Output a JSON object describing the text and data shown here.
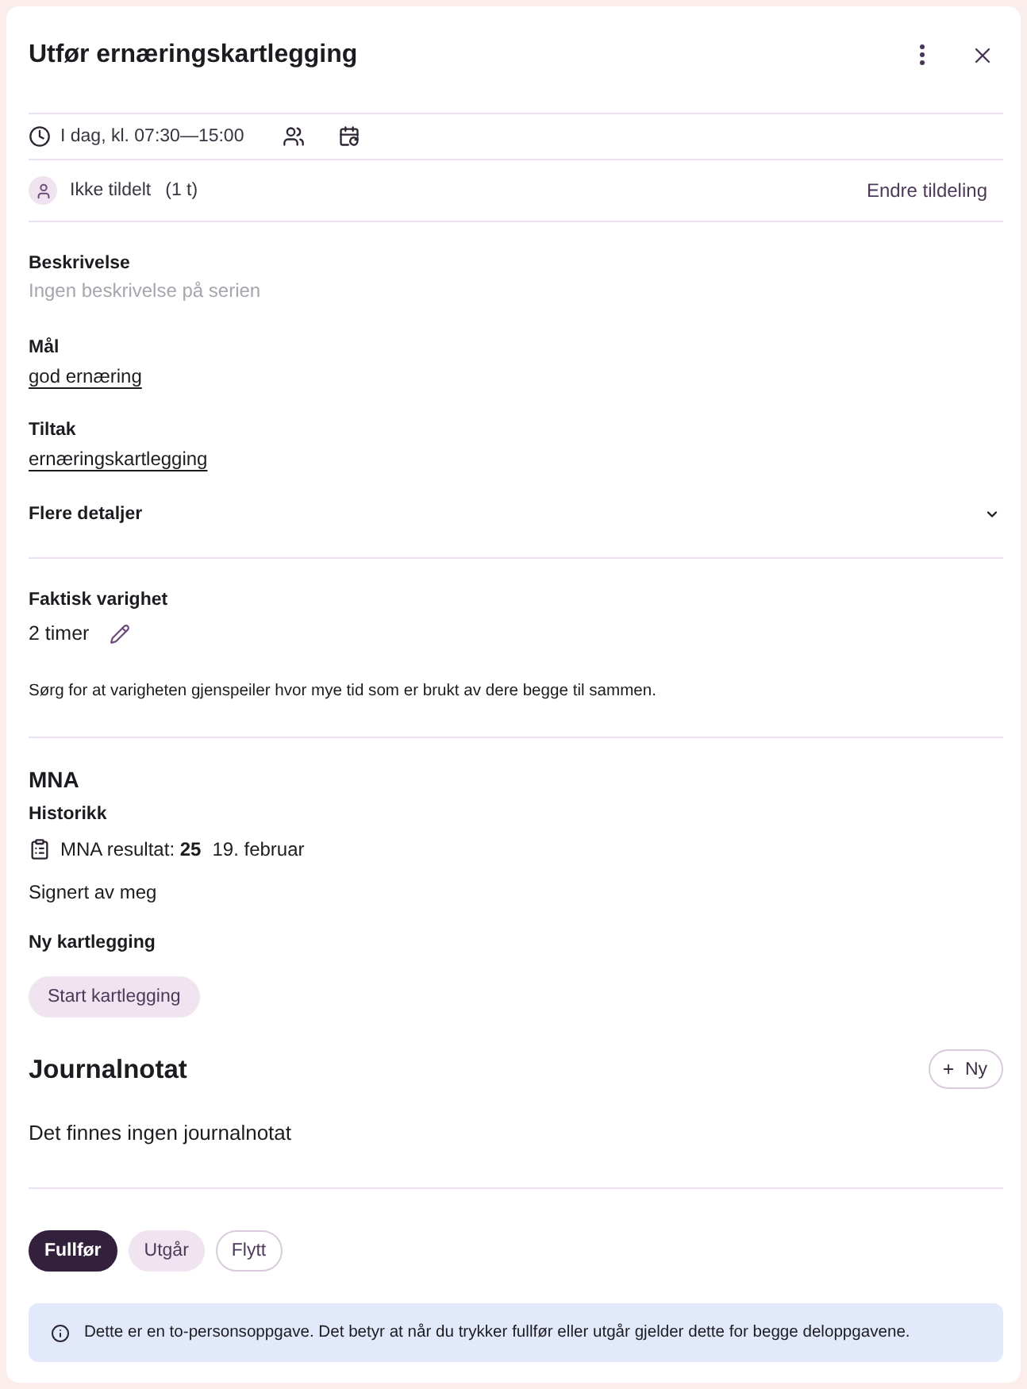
{
  "dialog": {
    "title": "Utfør ernæringskartlegging"
  },
  "schedule": {
    "time": "I dag, kl. 07:30—15:00"
  },
  "assignment": {
    "status": "Ikke tildelt",
    "count": "(1 t)",
    "action": "Endre tildeling"
  },
  "fields": [
    {
      "label": "Beskrivelse",
      "value": "Ingen beskrivelse på serien",
      "kind": "empty"
    },
    {
      "label": "Mål",
      "value": "god ernæring",
      "kind": "link"
    },
    {
      "label": "Tiltak",
      "value": "ernæringskartlegging",
      "kind": "link"
    }
  ],
  "details": {
    "label": "Flere detaljer",
    "expanded": false
  },
  "duration": {
    "label": "Faktisk varighet",
    "value": "2 timer",
    "note": "Sørg for at varigheten gjenspeiler hvor mye tid som er brukt av dere begge til sammen."
  },
  "mna": {
    "title": "MNA",
    "history_label": "Historikk",
    "result": "MNA resultat: **25**",
    "date": "19. februar",
    "signed": "Signert av meg",
    "new_label": "Ny kartlegging",
    "start_button": "Start kartlegging"
  },
  "journal": {
    "title": "Journalnotat",
    "new_button": "Ny",
    "empty": "Det finnes ingen journalnotat"
  },
  "actions": [
    {
      "label": "Fullfør",
      "kind": "primary"
    },
    {
      "label": "Utgår",
      "kind": "secondary"
    },
    {
      "label": "Flytt",
      "kind": "outline"
    }
  ],
  "info": "Dette er en to-personsoppgave. Det betyr at når du trykker fullfør eller utgår gjelder dette for begge deloppgavene."
}
